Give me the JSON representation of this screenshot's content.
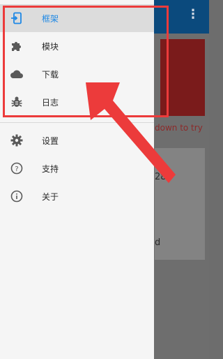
{
  "background": {
    "hint_text": "down to try",
    "card_text_1": "28)",
    "card_text_2": "d"
  },
  "drawer": {
    "primary_items": [
      {
        "label": "框架",
        "icon": "framework-icon",
        "active": true
      },
      {
        "label": "模块",
        "icon": "puzzle-icon",
        "active": false
      },
      {
        "label": "下载",
        "icon": "cloud-icon",
        "active": false
      },
      {
        "label": "日志",
        "icon": "bug-icon",
        "active": false
      }
    ],
    "secondary_items": [
      {
        "label": "设置",
        "icon": "gear-icon"
      },
      {
        "label": "支持",
        "icon": "help-icon"
      },
      {
        "label": "关于",
        "icon": "info-icon"
      }
    ]
  },
  "colors": {
    "accent": "#1e88e5",
    "app_bar": "#0b4a7d",
    "annotation": "#ec3b3b"
  }
}
